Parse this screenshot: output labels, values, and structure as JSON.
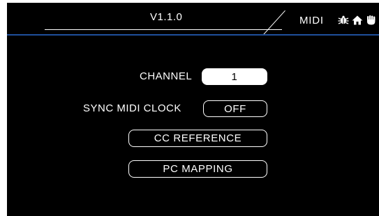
{
  "header": {
    "version": "V1.1.0",
    "page_name": "MIDI",
    "icons": [
      "bug-icon",
      "home-icon",
      "hand-icon"
    ]
  },
  "colors": {
    "background": "#000000",
    "accent_line": "#1f4f9c",
    "text": "#ffffff"
  },
  "settings": {
    "channel": {
      "label": "CHANNEL",
      "value": "1"
    },
    "sync_midi_clock": {
      "label": "SYNC MIDI CLOCK",
      "value": "OFF"
    }
  },
  "buttons": {
    "cc_reference": "CC REFERENCE",
    "pc_mapping": "PC MAPPING"
  }
}
